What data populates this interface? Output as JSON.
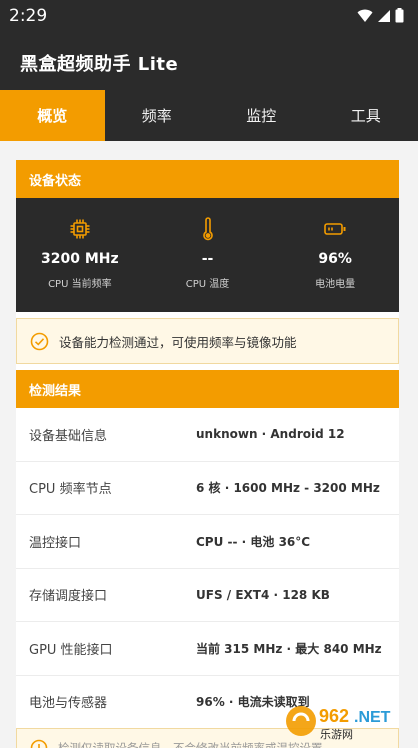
{
  "status_bar": {
    "time": "2:29"
  },
  "app": {
    "title": "黑盒超频助手 Lite"
  },
  "tabs": [
    {
      "label": "概览",
      "active": true
    },
    {
      "label": "频率",
      "active": false
    },
    {
      "label": "监控",
      "active": false
    },
    {
      "label": "工具",
      "active": false
    }
  ],
  "device_status": {
    "header": "设备状态",
    "stats": [
      {
        "icon": "cpu-chip-icon",
        "value": "3200 MHz",
        "label": "CPU 当前频率"
      },
      {
        "icon": "thermometer-icon",
        "value": "--",
        "label": "CPU 温度"
      },
      {
        "icon": "battery-icon",
        "value": "96%",
        "label": "电池电量"
      }
    ]
  },
  "notice": {
    "text": "设备能力检测通过，可使用频率与镜像功能"
  },
  "results": {
    "header": "检测结果",
    "rows": [
      {
        "key": "设备基础信息",
        "value": "unknown · Android 12"
      },
      {
        "key": "CPU 频率节点",
        "value": "6 核 · 1600 MHz - 3200 MHz"
      },
      {
        "key": "温控接口",
        "value": "CPU -- · 电池 36°C"
      },
      {
        "key": "存储调度接口",
        "value": "UFS / EXT4 · 128 KB"
      },
      {
        "key": "GPU 性能接口",
        "value": "当前 315 MHz · 最大 840 MHz"
      },
      {
        "key": "电池与传感器",
        "value": "96% · 电流未读取到"
      }
    ]
  },
  "footer_notice": {
    "text": "检测仅读取设备信息，不会修改当前频率或温控设置"
  },
  "watermark": {
    "text": "962.NET",
    "subtext": "乐游网"
  },
  "colors": {
    "accent": "#f39c00",
    "dark": "#2b2b2b",
    "stats_bg": "#2a2a2a"
  }
}
